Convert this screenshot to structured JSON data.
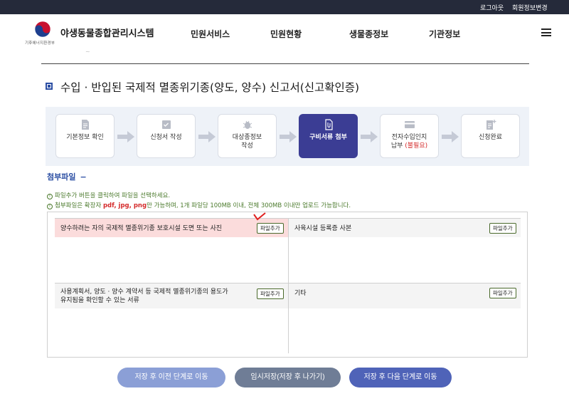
{
  "topbar": {
    "logout": "로그아웃",
    "member_edit": "회원정보변경"
  },
  "header": {
    "ministry": "기후에너지환경부",
    "site_title": "야생동물종합관리시스템",
    "nav": [
      "민원서비스",
      "민원현황",
      "생물종정보",
      "기관정보"
    ]
  },
  "page": {
    "title": "수입 · 반입된 국제적 멸종위기종(양도, 양수) 신고서(신고확인증)"
  },
  "steps": [
    {
      "label": "기본정보 확인",
      "icon": "document-icon"
    },
    {
      "label": "신청서 작성",
      "icon": "form-check-icon"
    },
    {
      "label_line1": "대상종정보",
      "label_line2": "작성",
      "icon": "bug-icon"
    },
    {
      "label": "구비서류 첨부",
      "icon": "attach-file-icon",
      "active": true
    },
    {
      "label_line1": "전자수입인지",
      "label_line2_prefix": "납부 ",
      "label_line2_red": "(불필요)",
      "icon": "card-icon"
    },
    {
      "label": "신청완료",
      "icon": "document-plus-icon"
    }
  ],
  "attach": {
    "heading": "첨부파일",
    "toggle": "−",
    "note1": "파일추가 버튼을 클릭하여 파일을 선택하세요.",
    "note2_prefix": "첨부파일은 확장자 ",
    "note2_ext": "pdf, jpg, png",
    "note2_suffix": "만 가능하며, 1개 파일당 100MB 이내, 전체 300MB 이내만 업로드 가능합니다.",
    "add_label": "파일추가",
    "cells": [
      {
        "text": "양수하려는 자의 국제적 멸종위기종 보호시설 도면 또는 사진"
      },
      {
        "text": "사육시설 등록증 사본"
      },
      {
        "line1": "사용계획서, 양도 · 양수 계약서 등 국제적 멸종위기종의 용도가",
        "line2": "유지됨을 확인할 수 있는 서류"
      },
      {
        "text": "기타"
      }
    ]
  },
  "buttons": {
    "prev": "저장 후 이전 단계로 이동",
    "temp": "임시저장(저장 후 나가기)",
    "next": "저장 후 다음 단계로 이동"
  },
  "colors": {
    "nav_dark": "#252a3a",
    "accent": "#3b3d94",
    "highlight": "#fbdcdc",
    "red": "#d42a2a"
  }
}
